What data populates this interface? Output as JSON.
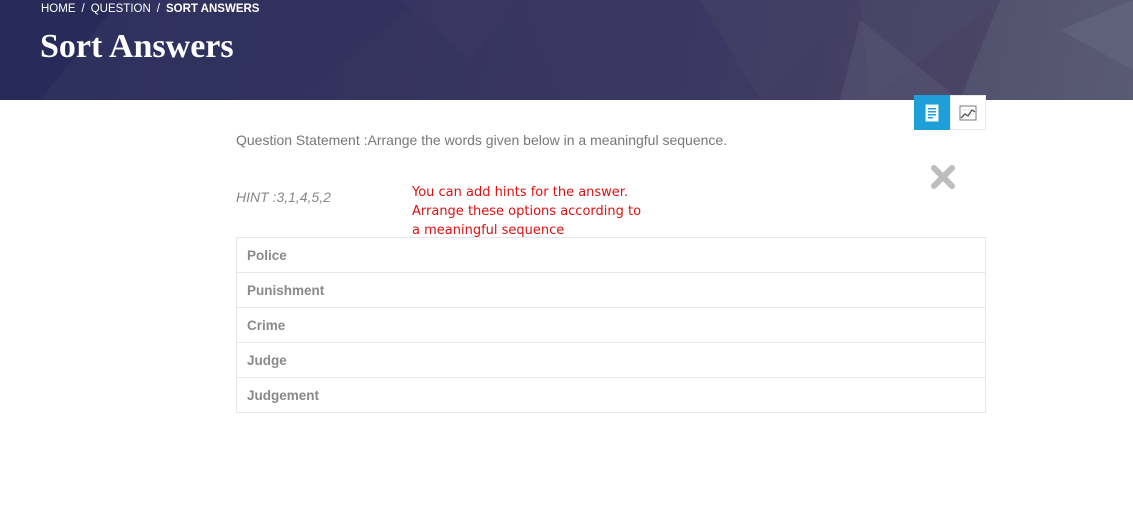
{
  "breadcrumb": {
    "home": "HOME",
    "question": "QUESTION",
    "current": "SORT ANSWERS",
    "separator": "/"
  },
  "header": {
    "title": "Sort Answers"
  },
  "view_toggle": {
    "items": [
      {
        "icon": "document-icon",
        "active": true
      },
      {
        "icon": "chart-icon",
        "active": false
      }
    ],
    "active_color": "#1e9fd8"
  },
  "question": {
    "statement": "Question Statement :Arrange the words given below in a meaningful sequence.",
    "hint": "HINT :3,1,4,5,2"
  },
  "annotation": {
    "lines": [
      "You can add hints for the answer.",
      "Arrange these options according to",
      "a meaningful sequence"
    ],
    "color": "#e01010"
  },
  "options": [
    {
      "label": "Police"
    },
    {
      "label": "Punishment"
    },
    {
      "label": "Crime"
    },
    {
      "label": "Judge"
    },
    {
      "label": "Judgement"
    }
  ],
  "close_icon": "close-icon"
}
